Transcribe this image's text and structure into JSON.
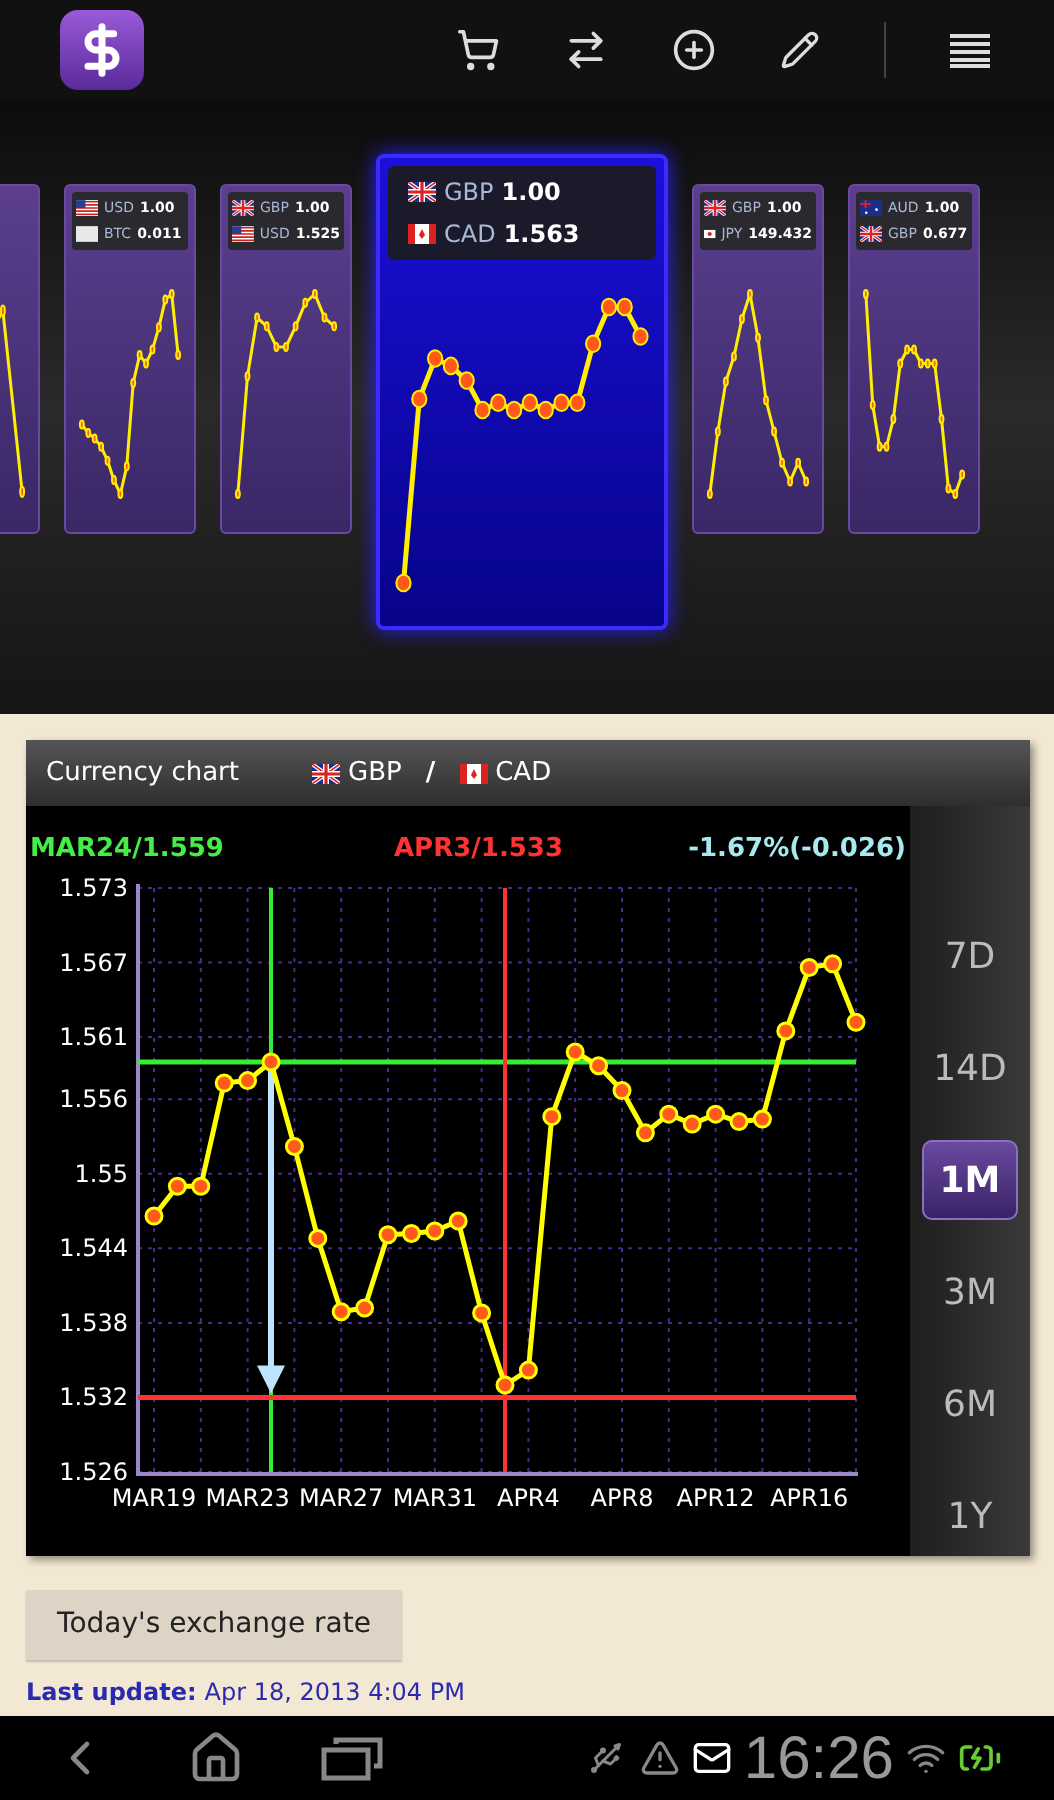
{
  "carousel": [
    {
      "selected": false
    },
    {
      "selected": false,
      "pairs": [
        {
          "kind": "us",
          "code": "USD",
          "amount": "1.00"
        },
        {
          "kind": "btc",
          "code": "BTC",
          "amount": "0.011"
        }
      ]
    },
    {
      "selected": false,
      "pairs": [
        {
          "kind": "uk",
          "code": "GBP",
          "amount": "1.00"
        },
        {
          "kind": "us",
          "code": "USD",
          "amount": "1.525"
        }
      ]
    },
    {
      "selected": true,
      "pairs": [
        {
          "kind": "uk",
          "code": "GBP",
          "amount": "1.00"
        },
        {
          "kind": "ca",
          "code": "CAD",
          "amount": "1.563"
        }
      ]
    },
    {
      "selected": false,
      "pairs": [
        {
          "kind": "uk",
          "code": "GBP",
          "amount": "1.00"
        },
        {
          "kind": "jp",
          "code": "JPY",
          "amount": "149.432"
        }
      ]
    },
    {
      "selected": false,
      "pairs": [
        {
          "kind": "au",
          "code": "AUD",
          "amount": "1.00"
        },
        {
          "kind": "uk",
          "code": "GBP",
          "amount": "0.677"
        }
      ]
    }
  ],
  "chart_panel": {
    "title": "Currency chart",
    "base": {
      "kind": "uk",
      "code": "GBP"
    },
    "separator": "/",
    "quote": {
      "kind": "ca",
      "code": "CAD"
    },
    "readouts": [
      {
        "kind": "high",
        "text": "MAR24/1.559"
      },
      {
        "kind": "low",
        "text": "APR3/1.533"
      },
      {
        "kind": "change",
        "text": "-1.67%(-0.026)"
      }
    ],
    "chart_data": {
      "type": "line",
      "categories": [
        "MAR19",
        null,
        null,
        null,
        "MAR23",
        null,
        null,
        null,
        "MAR27",
        null,
        null,
        null,
        "MAR31",
        null,
        null,
        null,
        "APR4",
        null,
        null,
        null,
        "APR8",
        null,
        null,
        null,
        "APR12",
        null,
        null,
        null,
        "APR16",
        null,
        null
      ],
      "series": [
        {
          "color": "#ffff00",
          "marker": "o",
          "values": [
            1.5466,
            1.549,
            1.549,
            1.5573,
            1.5575,
            1.559,
            1.5522,
            1.5448,
            1.5389,
            1.5392,
            1.5451,
            1.5452,
            1.5454,
            1.5462,
            1.5388,
            1.533,
            1.5342,
            1.5546,
            1.5598,
            1.5587,
            1.5567,
            1.5533,
            1.5548,
            1.554,
            1.5548,
            1.5542,
            1.5544,
            1.5615,
            1.5666,
            1.5669,
            1.5622
          ]
        }
      ],
      "ylim": [
        1.526,
        1.573
      ],
      "yticks": [
        1.526,
        1.532,
        1.538,
        1.544,
        1.55,
        1.556,
        1.561,
        1.567,
        1.573
      ],
      "grid": true,
      "ref_lines": [
        {
          "axis": "y",
          "value": 1.559,
          "color": "#33ee33"
        },
        {
          "axis": "y",
          "value": 1.532,
          "color": "#ff3333"
        }
      ]
    },
    "ranges": [
      {
        "label": "7D",
        "selected": false
      },
      {
        "label": "14D",
        "selected": false
      },
      {
        "label": "1M",
        "selected": true
      },
      {
        "label": "3M",
        "selected": false
      },
      {
        "label": "6M",
        "selected": false
      },
      {
        "label": "1Y",
        "selected": false
      }
    ]
  },
  "rate_button": "Today's exchange rate",
  "last_update": {
    "label": "Last update:",
    "value": "Apr 18, 2013 4:04 PM"
  },
  "status_bar": {
    "time": "16:26"
  }
}
